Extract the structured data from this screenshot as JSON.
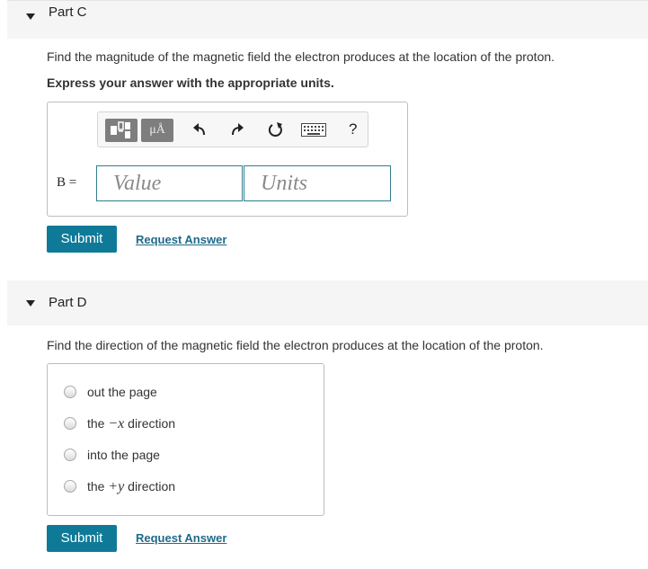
{
  "part_c": {
    "label": "Part C",
    "question": "Find the magnitude of the magnetic field the electron produces at the location of the proton.",
    "instruction": "Express your answer with the appropriate units.",
    "toolbar": {
      "units_button": "μÅ",
      "help": "?"
    },
    "variable": "B =",
    "value_placeholder": "Value",
    "units_placeholder": "Units",
    "submit": "Submit",
    "request_answer": "Request Answer"
  },
  "part_d": {
    "label": "Part D",
    "question": "Find the direction of the magnetic field the electron produces at the location of the proton.",
    "options": [
      {
        "prefix": "out the page",
        "math": "",
        "suffix": ""
      },
      {
        "prefix": "the ",
        "math": "−x",
        "suffix": " direction"
      },
      {
        "prefix": "into the page",
        "math": "",
        "suffix": ""
      },
      {
        "prefix": "the ",
        "math": "+y",
        "suffix": " direction"
      }
    ],
    "submit": "Submit",
    "request_answer": "Request Answer"
  },
  "colors": {
    "submit_bg": "#0f7a98",
    "link": "#1f6a8a",
    "field_border": "#2f7f8f",
    "part_bar_bg": "#f5f5f5"
  }
}
